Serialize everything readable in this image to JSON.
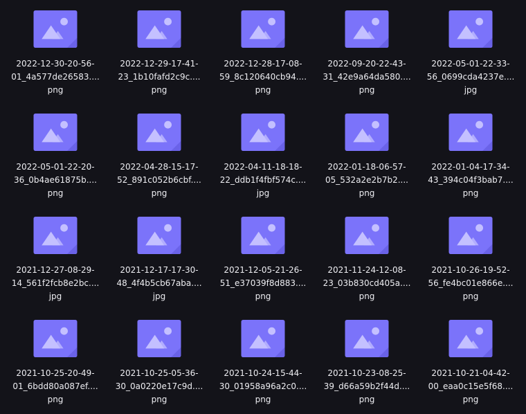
{
  "colors": {
    "background": "#131319",
    "icon_tile": "#7b73fa",
    "icon_fold": "#6a62e8",
    "icon_shape": "#c4c0ff",
    "text": "#eeeef2"
  },
  "files": [
    {
      "icon": "image-file-icon",
      "line1": "2022-12-30-20-56-",
      "line2": "01_4a577de26583....",
      "line3": "png"
    },
    {
      "icon": "image-file-icon",
      "line1": "2022-12-29-17-41-",
      "line2": "23_1b10fafd2c9c....",
      "line3": "png"
    },
    {
      "icon": "image-file-icon",
      "line1": "2022-12-28-17-08-",
      "line2": "59_8c120640cb94....",
      "line3": "png"
    },
    {
      "icon": "image-file-icon",
      "line1": "2022-09-20-22-43-",
      "line2": "31_42e9a64da580....",
      "line3": "png"
    },
    {
      "icon": "image-file-icon",
      "line1": "2022-05-01-22-33-",
      "line2": "56_0699cda4237e....",
      "line3": "jpg"
    },
    {
      "icon": "image-file-icon",
      "line1": "2022-05-01-22-20-",
      "line2": "36_0b4ae61875b....",
      "line3": "png"
    },
    {
      "icon": "image-file-icon",
      "line1": "2022-04-28-15-17-",
      "line2": "52_891c052b6cbf....",
      "line3": "png"
    },
    {
      "icon": "image-file-icon",
      "line1": "2022-04-11-18-18-",
      "line2": "22_ddb1f4fbf574c....",
      "line3": "jpg"
    },
    {
      "icon": "image-file-icon",
      "line1": "2022-01-18-06-57-",
      "line2": "05_532a2e2b7b2....",
      "line3": "png"
    },
    {
      "icon": "image-file-icon",
      "line1": "2022-01-04-17-34-",
      "line2": "43_394c04f3bab7....",
      "line3": "png"
    },
    {
      "icon": "image-file-icon",
      "line1": "2021-12-27-08-29-",
      "line2": "14_561f2fcb8e2bc....",
      "line3": "jpg"
    },
    {
      "icon": "image-file-icon",
      "line1": "2021-12-17-17-30-",
      "line2": "48_4f4b5cb67aba....",
      "line3": "jpg"
    },
    {
      "icon": "image-file-icon",
      "line1": "2021-12-05-21-26-",
      "line2": "51_e37039f8d883....",
      "line3": "png"
    },
    {
      "icon": "image-file-icon",
      "line1": "2021-11-24-12-08-",
      "line2": "23_03b830cd405a....",
      "line3": "png"
    },
    {
      "icon": "image-file-icon",
      "line1": "2021-10-26-19-52-",
      "line2": "56_fe4bc01e866e....",
      "line3": "png"
    },
    {
      "icon": "image-file-icon",
      "line1": "2021-10-25-20-49-",
      "line2": "01_6bdd80a087ef....",
      "line3": "png"
    },
    {
      "icon": "image-file-icon",
      "line1": "2021-10-25-05-36-",
      "line2": "30_0a0220e17c9d....",
      "line3": "png"
    },
    {
      "icon": "image-file-icon",
      "line1": "2021-10-24-15-44-",
      "line2": "30_01958a96a2c0....",
      "line3": "png"
    },
    {
      "icon": "image-file-icon",
      "line1": "2021-10-23-08-25-",
      "line2": "39_d66a59b2f44d....",
      "line3": "png"
    },
    {
      "icon": "image-file-icon",
      "line1": "2021-10-21-04-42-",
      "line2": "00_eaa0c15e5f68....",
      "line3": "png"
    }
  ]
}
